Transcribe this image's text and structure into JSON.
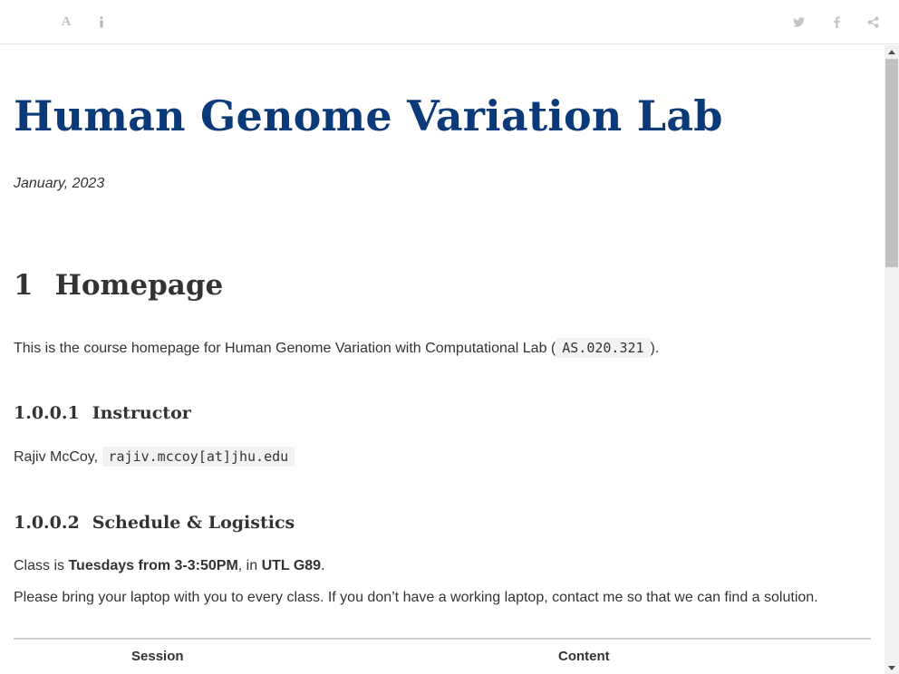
{
  "toolbar": {
    "font_button_label": "A",
    "left_icons": [
      "font-settings-icon",
      "info-icon"
    ],
    "right_icons": [
      "twitter-icon",
      "facebook-icon",
      "share-icon"
    ]
  },
  "page": {
    "title": "Human Genome Variation Lab",
    "date": "January, 2023"
  },
  "section1": {
    "number": "1",
    "heading": "Homepage",
    "intro_before": "This is the course homepage for Human Genome Variation with Computational Lab (",
    "course_code": "AS.020.321",
    "intro_after": ")."
  },
  "instructor": {
    "number": "1.0.0.1",
    "heading": "Instructor",
    "name": "Rajiv McCoy,",
    "email": "rajiv.mccoy[at]jhu.edu"
  },
  "schedule": {
    "number": "1.0.0.2",
    "heading": "Schedule & Logistics",
    "class_prefix": "Class is ",
    "class_time": "Tuesdays from 3-3:50PM",
    "class_mid": ", in ",
    "class_room": "UTL G89",
    "class_end": ".",
    "laptop_note": "Please bring your laptop with you to every class. If you don’t have a working laptop, contact me so that we can find a solution."
  },
  "table": {
    "headers": [
      "Session",
      "Content"
    ]
  },
  "colors": {
    "title": "#0b3a78",
    "text": "#333333",
    "icon": "#bdbdbd"
  }
}
